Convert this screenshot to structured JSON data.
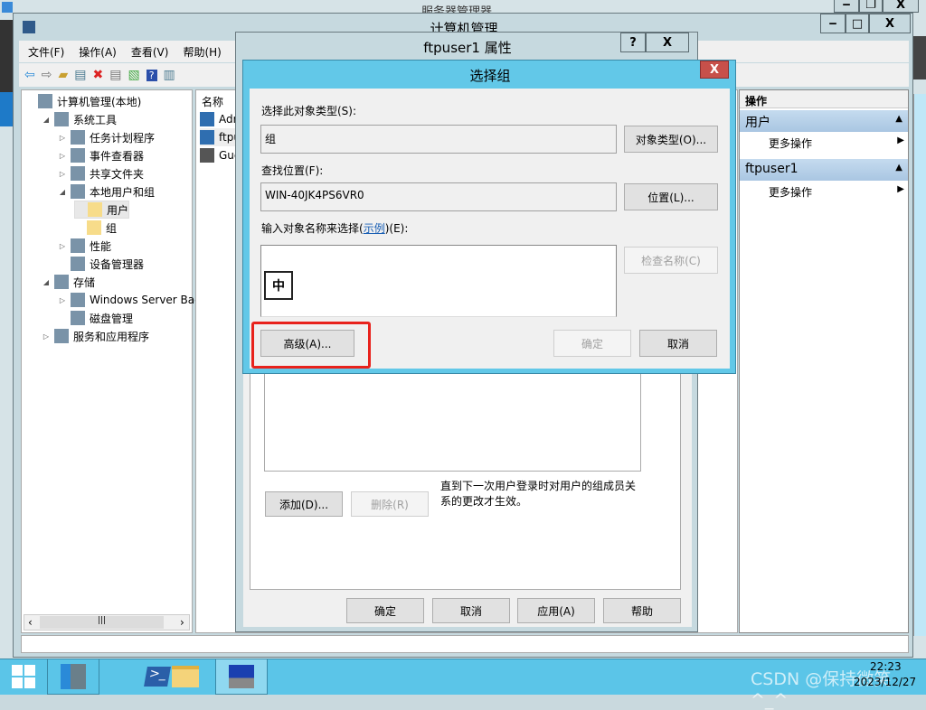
{
  "background_window": {
    "title": "服务器管理器"
  },
  "window": {
    "title": "计算机管理"
  },
  "menu": [
    "文件(F)",
    "操作(A)",
    "查看(V)",
    "帮助(H)"
  ],
  "tree": [
    {
      "label": "计算机管理(本地)",
      "level": 0,
      "expander": "",
      "icon": "computer-icon"
    },
    {
      "label": "系统工具",
      "level": 1,
      "expander": "◢",
      "icon": "tools-icon"
    },
    {
      "label": "任务计划程序",
      "level": 2,
      "expander": "▷",
      "icon": "clock-icon"
    },
    {
      "label": "事件查看器",
      "level": 2,
      "expander": "▷",
      "icon": "event-log-icon"
    },
    {
      "label": "共享文件夹",
      "level": 2,
      "expander": "▷",
      "icon": "shared-folder-icon"
    },
    {
      "label": "本地用户和组",
      "level": 2,
      "expander": "◢",
      "icon": "users-icon"
    },
    {
      "label": "用户",
      "level": 3,
      "expander": "",
      "icon": "folder-icon",
      "selected": true
    },
    {
      "label": "组",
      "level": 3,
      "expander": "",
      "icon": "folder-icon"
    },
    {
      "label": "性能",
      "level": 2,
      "expander": "▷",
      "icon": "performance-icon"
    },
    {
      "label": "设备管理器",
      "level": 2,
      "expander": "",
      "icon": "device-manager-icon"
    },
    {
      "label": "存储",
      "level": 1,
      "expander": "◢",
      "icon": "storage-icon"
    },
    {
      "label": "Windows Server Back",
      "level": 2,
      "expander": "▷",
      "icon": "backup-icon"
    },
    {
      "label": "磁盘管理",
      "level": 2,
      "expander": "",
      "icon": "disk-icon"
    },
    {
      "label": "服务和应用程序",
      "level": 1,
      "expander": "▷",
      "icon": "services-icon"
    }
  ],
  "list": {
    "header": "名称",
    "items": [
      "Adm",
      "ftpu",
      "Gue"
    ]
  },
  "actions": {
    "header": "操作",
    "sections": [
      {
        "title": "用户",
        "item": "更多操作"
      },
      {
        "title": "ftpuser1",
        "item": "更多操作"
      }
    ]
  },
  "properties": {
    "title": "ftpuser1 属性",
    "help": "?",
    "close": "X",
    "note": "直到下一次用户登录时对用户的组成员关系的更改才生效。",
    "add": "添加(D)...",
    "remove": "删除(R)",
    "ok": "确定",
    "cancel": "取消",
    "apply": "应用(A)",
    "helpbtn": "帮助"
  },
  "select_group": {
    "title": "选择组",
    "close": "X",
    "type_label": "选择此对象类型(S):",
    "type_value": "组",
    "type_btn": "对象类型(O)...",
    "loc_label": "查找位置(F):",
    "loc_value": "WIN-40JK4PS6VR0",
    "loc_btn": "位置(L)...",
    "name_label_pre": "输入对象名称来选择(",
    "name_link": "示例",
    "name_label_post": ")(E):",
    "ime": "中",
    "check": "检查名称(C)",
    "advanced": "高级(A)...",
    "ok": "确定",
    "cancel": "取消"
  },
  "taskbar": {
    "time": "22:23",
    "date": "2023/12/27",
    "watermark": "CSDN @保持微笑^_^"
  },
  "colors": {
    "accent": "#5bc5e8",
    "highlight": "#e8221c",
    "close": "#c7504a"
  }
}
